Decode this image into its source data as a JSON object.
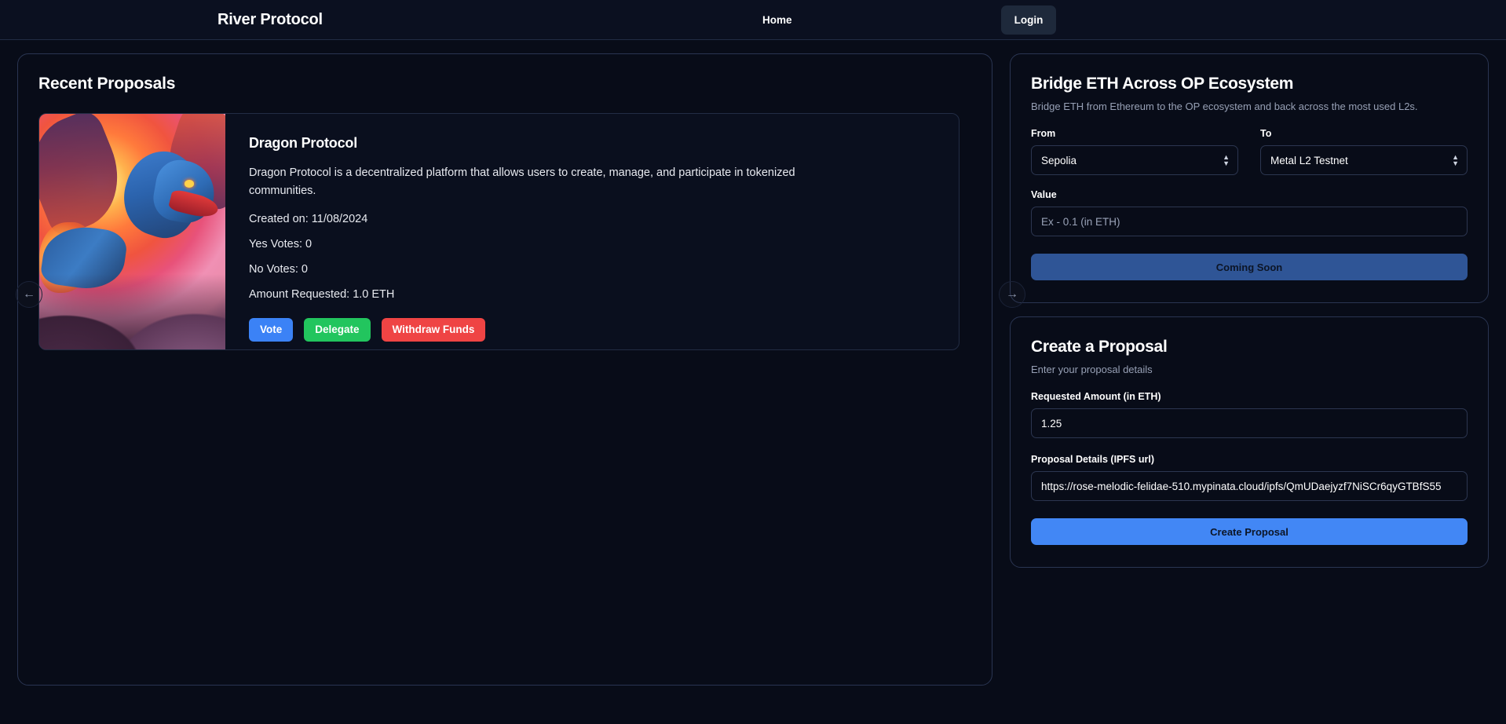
{
  "header": {
    "brand": "River Protocol",
    "nav_home": "Home",
    "login_label": "Login"
  },
  "left_panel": {
    "title": "Recent Proposals",
    "prev_arrow_icon": "arrow-left-icon",
    "next_arrow_icon": "arrow-right-icon",
    "proposal": {
      "title": "Dragon Protocol",
      "description": "Dragon Protocol is a decentralized platform that allows users to create, manage, and participate in tokenized communities.",
      "created_on": "Created on: 11/08/2024",
      "yes_votes": "Yes Votes: 0",
      "no_votes": "No Votes: 0",
      "amount_requested": "Amount Requested: 1.0 ETH",
      "thumbnail_alt": "pixel-art dragon on mountain at sunset",
      "actions": {
        "vote": "Vote",
        "delegate": "Delegate",
        "withdraw": "Withdraw Funds"
      }
    }
  },
  "bridge_card": {
    "title": "Bridge ETH Across OP Ecosystem",
    "subtitle": "Bridge ETH from Ethereum to the OP ecosystem and back across the most used L2s.",
    "from_label": "From",
    "from_value": "Sepolia",
    "to_label": "To",
    "to_value": "Metal L2 Testnet",
    "value_label": "Value",
    "value_placeholder": "Ex - 0.1 (in ETH)",
    "value_current": "",
    "submit_label": "Coming Soon"
  },
  "proposal_card": {
    "title": "Create a Proposal",
    "subtitle": "Enter your proposal details",
    "amount_label": "Requested Amount (in ETH)",
    "amount_value": "1.25",
    "details_label": "Proposal Details (IPFS url)",
    "details_value": "https://rose-melodic-felidae-510.mypinata.cloud/ipfs/QmUDaejyzf7NiSCr6qyGTBfS55",
    "submit_label": "Create Proposal"
  },
  "colors": {
    "page_bg": "#080c18",
    "nav_bg": "#0b1020",
    "card_border": "#2a3552",
    "accent_blue": "#4287f5",
    "vote_blue": "#3b82f6",
    "delegate_green": "#22c55e",
    "withdraw_red": "#ef4444",
    "coming_soon_blue": "#2f5596"
  }
}
